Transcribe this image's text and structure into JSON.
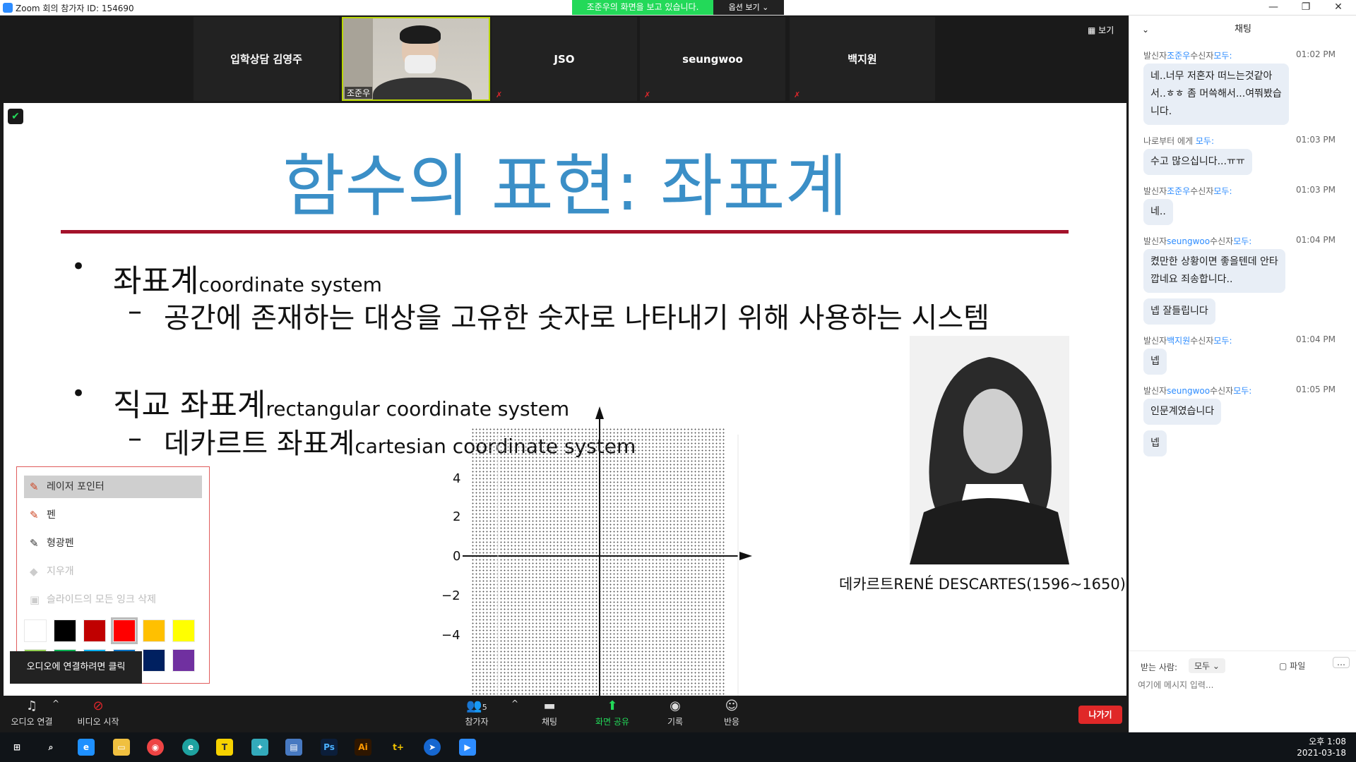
{
  "window": {
    "title": "Zoom 회의 참가자 ID: 154690",
    "share_banner": "조준우의 화면을 보고 있습니다.",
    "view_options": "옵션 보기"
  },
  "video_strip": {
    "view_label": "보기",
    "tiles": [
      {
        "name": "입학상담 김영주"
      },
      {
        "name": "조준우"
      },
      {
        "name": "JSO"
      },
      {
        "name": "seungwoo"
      },
      {
        "name": "백지원"
      }
    ]
  },
  "slide": {
    "title": "함수의 표현: 좌표계",
    "line1_main": "좌표계",
    "line1_sub": "coordinate system",
    "line2": "공간에 존재하는 대상을 고유한 숫자로 나타내기 위해 사용하는 시스템",
    "line3_main": "직교 좌표계",
    "line3_sub": "rectangular coordinate system",
    "line4_main": "데카르트 좌표계",
    "line4_sub": "cartesian coordinate system",
    "caption": "데카르트RENÉ DESCARTES(1596~1650)",
    "y_ticks": [
      "4",
      "2",
      "0",
      "−2",
      "−4"
    ]
  },
  "annotation_menu": {
    "items": [
      {
        "label": "레이저 포인터",
        "icon": "laser-icon",
        "active": true
      },
      {
        "label": "펜",
        "icon": "pen-icon"
      },
      {
        "label": "형광펜",
        "icon": "highlighter-icon"
      },
      {
        "label": "지우개",
        "icon": "eraser-icon"
      },
      {
        "label": "슬라이드의 모든 잉크 삭제",
        "icon": "clear-ink-icon"
      }
    ],
    "colors_row1": [
      "#ffffff",
      "#000000",
      "#c00000",
      "#ff0000",
      "#ffc000",
      "#ffff00"
    ],
    "colors_row2": [
      "#92d050",
      "#00b050",
      "#00b0f0",
      "#0070c0",
      "#002060",
      "#7030a0"
    ],
    "tooltip": "오디오에 연결하려면 클릭"
  },
  "toolbar": {
    "audio": "오디오 연결",
    "video": "비디오 시작",
    "participants": "참가자",
    "participants_count": "5",
    "chat": "채팅",
    "share": "화면 공유",
    "record": "기록",
    "reactions": "반응",
    "leave": "나가기"
  },
  "chat": {
    "title": "채팅",
    "messages": [
      {
        "meta_from": "발신자",
        "from": "조준우",
        "meta_to": "수신자",
        "to": "모두:",
        "time": "01:02 PM",
        "bubbles": [
          "네..너무 저혼자 떠느는것같아\n서..ㅎㅎ 좀 머쓱해서...여쭤봤습\n니다."
        ]
      },
      {
        "meta_from": "나로부터 에게 ",
        "from": "",
        "meta_to": "",
        "to": "모두:",
        "time": "01:03 PM",
        "bubbles": [
          "수고 많으십니다...ㅠㅠ"
        ]
      },
      {
        "meta_from": "발신자",
        "from": "조준우",
        "meta_to": "수신자",
        "to": "모두:",
        "time": "01:03 PM",
        "bubbles": [
          "네.."
        ]
      },
      {
        "meta_from": "발신자",
        "from": "seungwoo",
        "meta_to": "수신자",
        "to": "모두:",
        "time": "01:04 PM",
        "bubbles": [
          "켰만한 상황이면 좋을텐데 안타\n깝네요 죄송합니다..",
          "넵 잘들립니다"
        ]
      },
      {
        "meta_from": "발신자",
        "from": "백지원",
        "meta_to": "수신자",
        "to": "모두:",
        "time": "01:04 PM",
        "bubbles": [
          "넵"
        ]
      },
      {
        "meta_from": "발신자",
        "from": "seungwoo",
        "meta_to": "수신자",
        "to": "모두:",
        "time": "01:05 PM",
        "bubbles": [
          "인문계였습니다",
          "넵"
        ]
      }
    ],
    "recipient_label": "받는 사람:",
    "recipient": "모두",
    "file": "파일",
    "input_placeholder": "여기에 메시지 입력..."
  },
  "taskbar": {
    "time": "오후 1:08",
    "date": "2021-03-18"
  }
}
